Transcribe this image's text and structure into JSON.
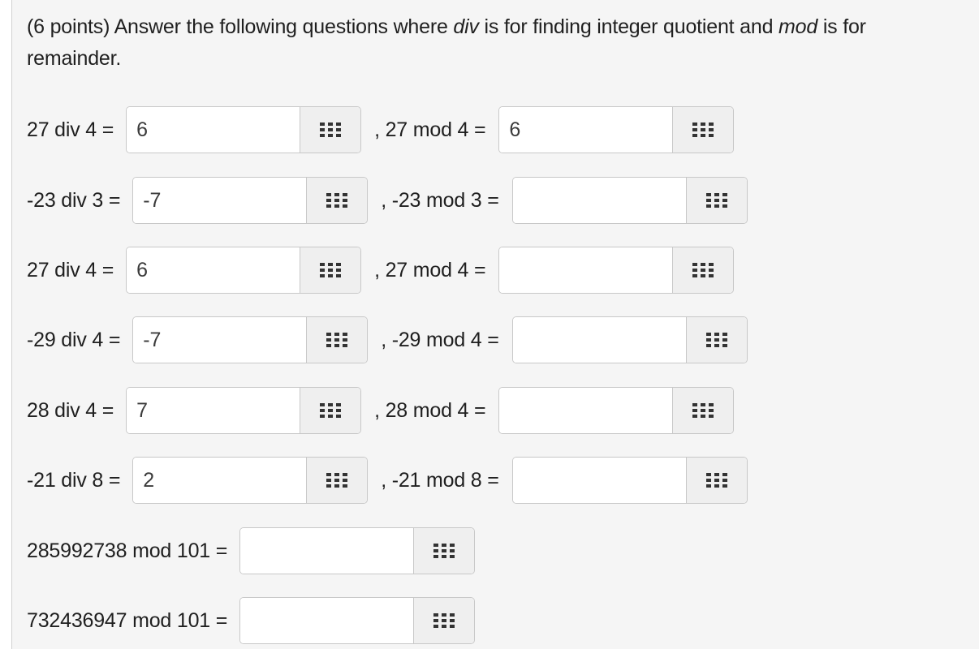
{
  "question": {
    "prefix": "(6 points) Answer the following questions where ",
    "em1": "div",
    "mid": " is for finding integer quotient and ",
    "em2": "mod",
    "suffix": " is for",
    "line2": "remainder."
  },
  "rows": [
    {
      "div_label": "27 div 4 =",
      "div_value": "6",
      "mod_label": ", 27 mod 4 =",
      "mod_value": "6"
    },
    {
      "div_label": "-23 div 3 =",
      "div_value": "-7",
      "mod_label": ", -23 mod 3 =",
      "mod_value": ""
    },
    {
      "div_label": "27 div 4 =",
      "div_value": "6",
      "mod_label": ", 27 mod 4 =",
      "mod_value": ""
    },
    {
      "div_label": "-29 div 4 =",
      "div_value": "-7",
      "mod_label": ", -29 mod 4 =",
      "mod_value": ""
    },
    {
      "div_label": "28 div 4 =",
      "div_value": "7",
      "mod_label": ", 28 mod 4 =",
      "mod_value": ""
    },
    {
      "div_label": "-21 div 8 =",
      "div_value": "2",
      "mod_label": ", -21 mod 8 =",
      "mod_value": ""
    }
  ],
  "single_rows": [
    {
      "label": "285992738 mod 101 =",
      "value": ""
    },
    {
      "label": "732436947 mod 101 =",
      "value": ""
    }
  ],
  "icons": {
    "keypad": "keypad-grid-icon"
  }
}
